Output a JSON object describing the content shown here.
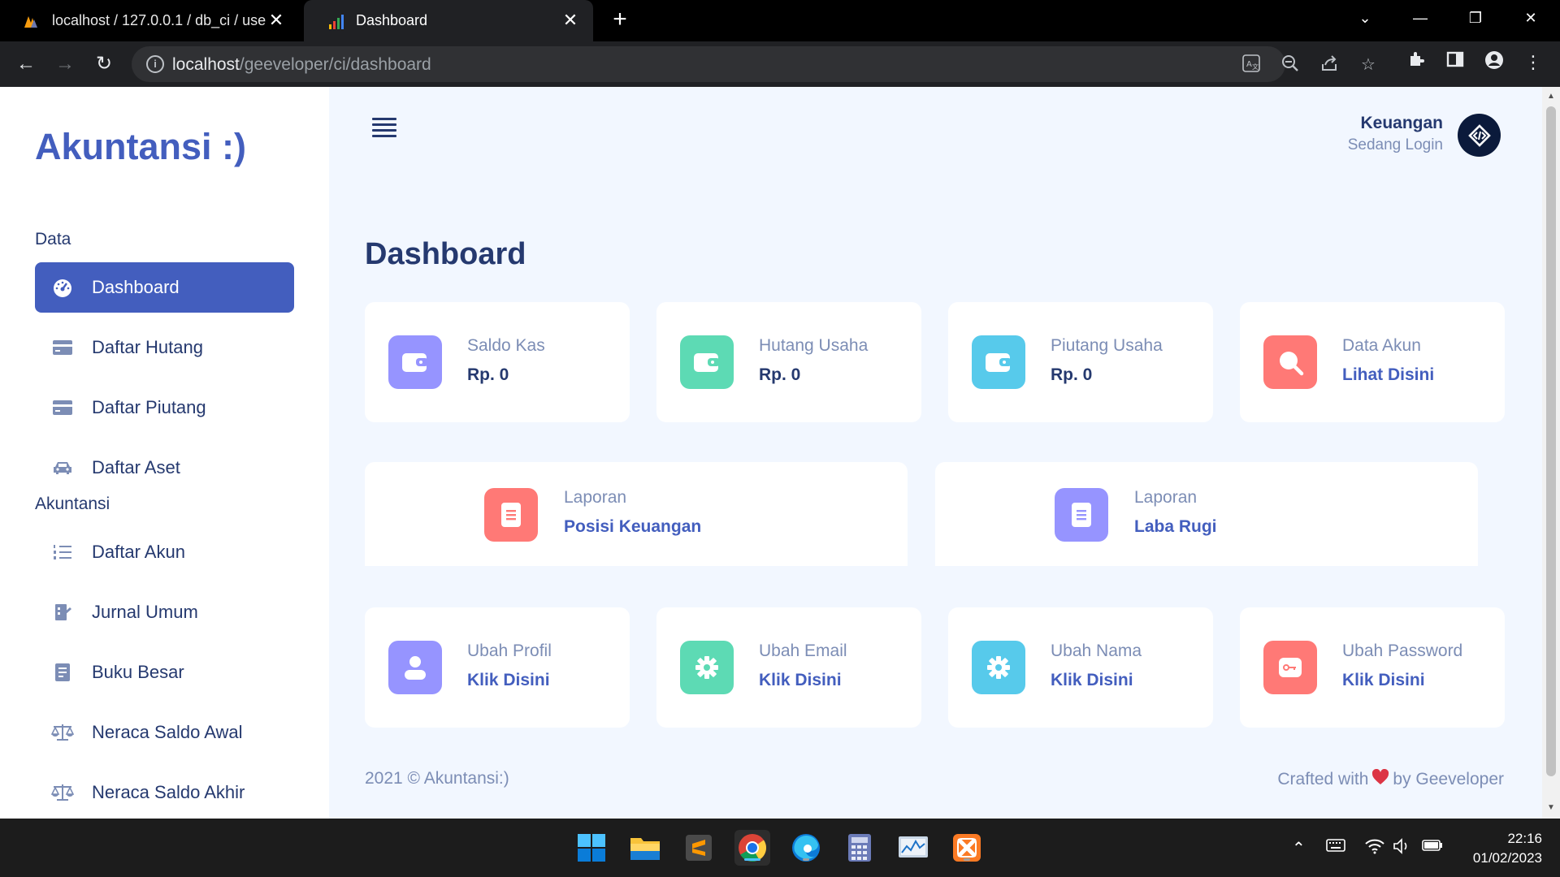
{
  "browser": {
    "tabs": [
      {
        "title": "localhost / 127.0.0.1 / db_ci / use",
        "close": "✕"
      },
      {
        "title": "Dashboard",
        "close": "✕"
      }
    ],
    "new_tab": "+",
    "url_host": "localhost",
    "url_path": "/geeveloper/ci/dashboard"
  },
  "sidebar": {
    "brand": "Akuntansi :)",
    "sections": [
      {
        "title": "Data"
      },
      {
        "title": "Akuntansi"
      }
    ],
    "items": [
      {
        "label": "Dashboard",
        "icon": "speedometer-icon"
      },
      {
        "label": "Daftar Hutang",
        "icon": "credit-card-icon"
      },
      {
        "label": "Daftar Piutang",
        "icon": "credit-card-icon"
      },
      {
        "label": "Daftar Aset",
        "icon": "car-icon"
      },
      {
        "label": "Daftar Akun",
        "icon": "list-ol-icon"
      },
      {
        "label": "Jurnal Umum",
        "icon": "journal-icon"
      },
      {
        "label": "Buku Besar",
        "icon": "book-icon"
      },
      {
        "label": "Neraca Saldo Awal",
        "icon": "scale-icon"
      },
      {
        "label": "Neraca Saldo Akhir",
        "icon": "scale-icon"
      }
    ]
  },
  "header": {
    "user_name": "Keuangan",
    "user_status": "Sedang Login"
  },
  "main": {
    "title": "Dashboard",
    "row1": [
      {
        "label": "Saldo Kas",
        "value": "Rp. 0",
        "icon": "wallet-icon",
        "color": "#9694ff"
      },
      {
        "label": "Hutang Usaha",
        "value": "Rp. 0",
        "icon": "wallet-icon",
        "color": "#5ddab4"
      },
      {
        "label": "Piutang Usaha",
        "value": "Rp. 0",
        "icon": "wallet-icon",
        "color": "#57caeb"
      },
      {
        "label": "Data Akun",
        "value": "Lihat Disini",
        "icon": "search-icon",
        "color": "#ff7976"
      }
    ],
    "row2": [
      {
        "label": "Laporan",
        "value": "Posisi Keuangan",
        "icon": "document-icon",
        "color": "#ff7976"
      },
      {
        "label": "Laporan",
        "value": "Laba Rugi",
        "icon": "document-icon",
        "color": "#9694ff"
      }
    ],
    "row3": [
      {
        "label": "Ubah Profil",
        "value": "Klik Disini",
        "icon": "person-icon",
        "color": "#9694ff"
      },
      {
        "label": "Ubah Email",
        "value": "Klik Disini",
        "icon": "gear-icon",
        "color": "#5ddab4"
      },
      {
        "label": "Ubah Nama",
        "value": "Klik Disini",
        "icon": "gear-icon",
        "color": "#57caeb"
      },
      {
        "label": "Ubah Password",
        "value": "Klik Disini",
        "icon": "key-icon",
        "color": "#ff7976"
      }
    ]
  },
  "footer": {
    "left": "2021 © Akuntansi:)",
    "right_pre": "Crafted with",
    "right_post": "by Geeveloper"
  },
  "taskbar": {
    "time": "22:16",
    "date": "01/02/2023"
  }
}
